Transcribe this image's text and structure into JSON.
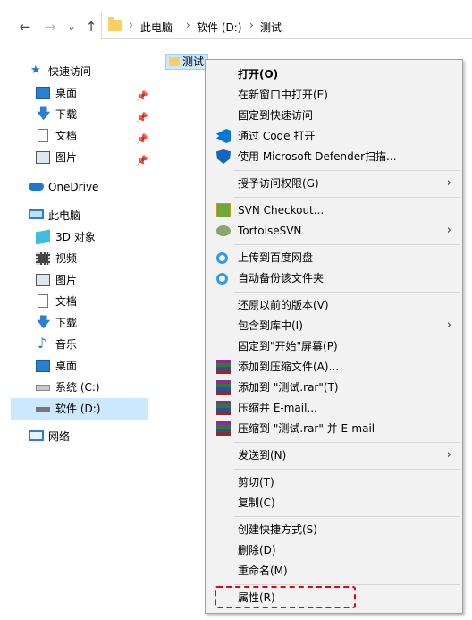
{
  "address": {
    "crumbs": [
      "此电脑",
      "软件 (D:)",
      "测试"
    ],
    "sep": "›"
  },
  "nav_buttons": {
    "back": "←",
    "forward": "→",
    "dropdown": "⌄",
    "up": "↑"
  },
  "sidebar": {
    "quick_access": "快速访问",
    "quick_items": [
      "桌面",
      "下载",
      "文档",
      "图片"
    ],
    "onedrive": "OneDrive",
    "this_pc": "此电脑",
    "pc_items": [
      "3D 对象",
      "视频",
      "图片",
      "文档",
      "下载",
      "音乐",
      "桌面",
      "系统 (C:)",
      "软件 (D:)"
    ],
    "network": "网络"
  },
  "file": {
    "name": "测试"
  },
  "menu": {
    "items": [
      "打开(O)",
      "在新窗口中打开(E)",
      "固定到快速访问",
      "通过 Code 打开",
      "使用 Microsoft Defender扫描...",
      "授予访问权限(G)",
      "SVN Checkout...",
      "TortoiseSVN",
      "上传到百度网盘",
      "自动备份该文件夹",
      "还原以前的版本(V)",
      "包含到库中(I)",
      "固定到\"开始\"屏幕(P)",
      "添加到压缩文件(A)...",
      "添加到 \"测试.rar\"(T)",
      "压缩并 E-mail...",
      "压缩到 \"测试.rar\" 并 E-mail",
      "发送到(N)",
      "剪切(T)",
      "复制(C)",
      "创建快捷方式(S)",
      "删除(D)",
      "重命名(M)",
      "属性(R)"
    ],
    "submenu_arrow": "›"
  },
  "colors": {
    "selection": "#cce8ff",
    "folder": "#f7cf63",
    "highlight_border": "#e60012"
  }
}
